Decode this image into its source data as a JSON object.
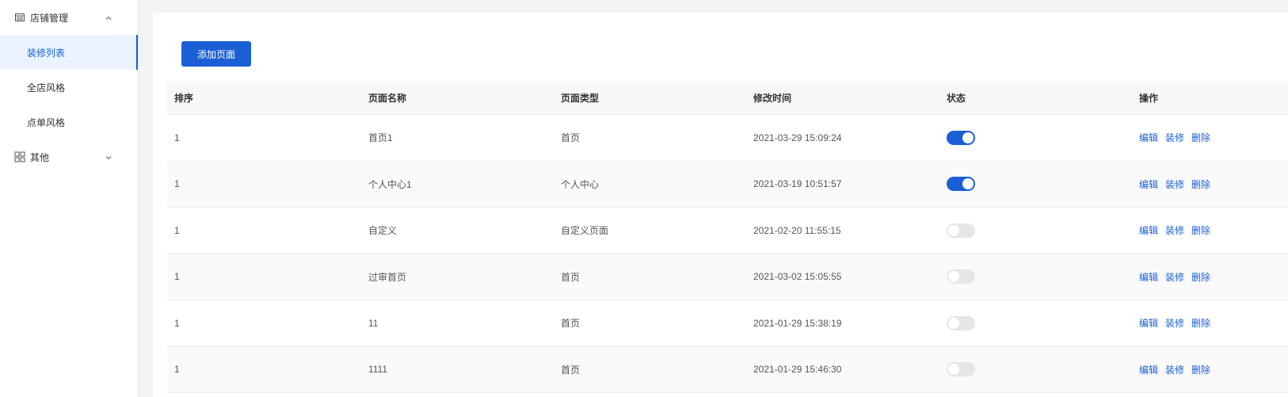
{
  "sidebar": {
    "groups": [
      {
        "label": "店铺管理",
        "icon": "shop-icon",
        "expanded": true,
        "items": [
          {
            "label": "装修列表",
            "active": true
          },
          {
            "label": "全店风格",
            "active": false
          },
          {
            "label": "点单风格",
            "active": false
          }
        ]
      },
      {
        "label": "其他",
        "icon": "grid-icon",
        "expanded": false,
        "items": []
      }
    ]
  },
  "toolbar": {
    "add_label": "添加页面"
  },
  "table": {
    "headers": [
      "排序",
      "页面名称",
      "页面类型",
      "修改时间",
      "状态",
      "操作"
    ],
    "actions": [
      "编辑",
      "装修",
      "删除"
    ],
    "rows": [
      {
        "order": "1",
        "name": "首页1",
        "type": "首页",
        "time": "2021-03-29 15:09:24",
        "enabled": true
      },
      {
        "order": "1",
        "name": "个人中心1",
        "type": "个人中心",
        "time": "2021-03-19 10:51:57",
        "enabled": true
      },
      {
        "order": "1",
        "name": "自定义",
        "type": "自定义页面",
        "time": "2021-02-20 11:55:15",
        "enabled": false
      },
      {
        "order": "1",
        "name": "过审首页",
        "type": "首页",
        "time": "2021-03-02 15:05:55",
        "enabled": false
      },
      {
        "order": "1",
        "name": "11",
        "type": "首页",
        "time": "2021-01-29 15:38:19",
        "enabled": false
      },
      {
        "order": "1",
        "name": "1111",
        "type": "首页",
        "time": "2021-01-29 15:46:30",
        "enabled": false
      }
    ]
  },
  "colors": {
    "accent": "#1a5fd6",
    "active_bg": "#eaf3ff",
    "switch_off": "#e6e6e6"
  }
}
